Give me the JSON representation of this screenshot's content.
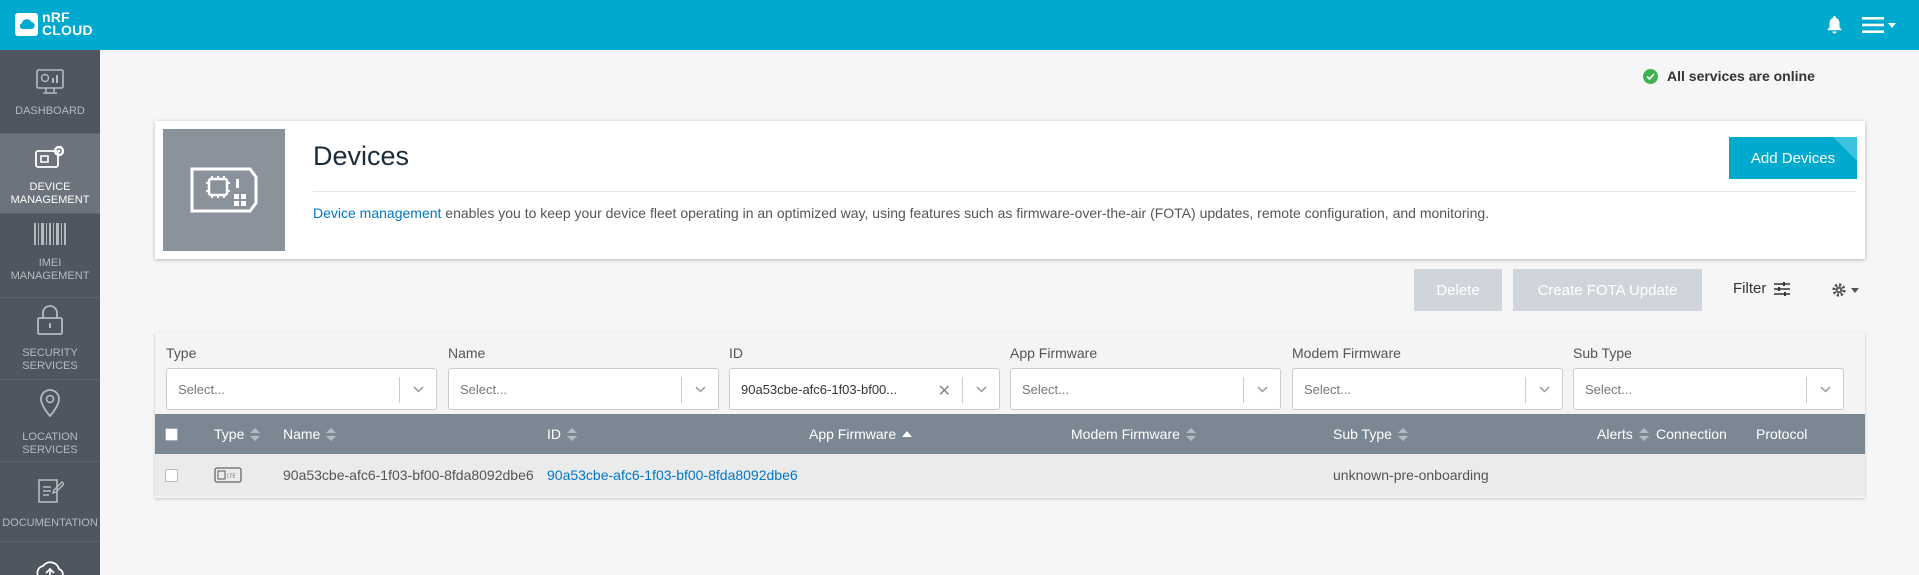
{
  "app": {
    "logo_line1": "nRF",
    "logo_line2": "CLOUD"
  },
  "sidebar": {
    "items": [
      {
        "label_line1": "DASHBOARD",
        "label_line2": ""
      },
      {
        "label_line1": "DEVICE",
        "label_line2": "MANAGEMENT"
      },
      {
        "label_line1": "IMEI",
        "label_line2": "MANAGEMENT"
      },
      {
        "label_line1": "SECURITY",
        "label_line2": "SERVICES"
      },
      {
        "label_line1": "LOCATION",
        "label_line2": "SERVICES"
      },
      {
        "label_line1": "DOCUMENTATION",
        "label_line2": ""
      }
    ]
  },
  "status": {
    "text": "All services are online",
    "color": "#3fb24f"
  },
  "devices_card": {
    "title": "Devices",
    "desc_link": "Device management",
    "desc_text": " enables you to keep your device fleet operating in an optimized way, using features such as firmware-over-the-air (FOTA) updates, remote configuration, and monitoring.",
    "add_button": "Add Devices"
  },
  "toolbar": {
    "delete": "Delete",
    "create_fota": "Create FOTA Update",
    "filter": "Filter"
  },
  "filters": [
    {
      "label": "Type",
      "placeholder": "Select..."
    },
    {
      "label": "Name",
      "placeholder": "Select..."
    },
    {
      "label": "ID",
      "value": "90a53cbe-afc6-1f03-bf00..."
    },
    {
      "label": "App Firmware",
      "placeholder": "Select..."
    },
    {
      "label": "Modem Firmware",
      "placeholder": "Select..."
    },
    {
      "label": "Sub Type",
      "placeholder": "Select..."
    }
  ],
  "table": {
    "columns": [
      "Type",
      "Name",
      "ID",
      "App Firmware",
      "Modem Firmware",
      "Sub Type",
      "Alerts",
      "Connection",
      "Protocol"
    ],
    "rows": [
      {
        "type_icon": "lte-device-icon",
        "type_badge": "LTE",
        "name": "90a53cbe-afc6-1f03-bf00-8fda8092dbe6",
        "id": "90a53cbe-afc6-1f03-bf00-8fda8092dbe6",
        "app_firmware": "",
        "modem_firmware": "",
        "sub_type": "unknown-pre-onboarding",
        "alerts": "",
        "connection": "",
        "protocol": ""
      }
    ]
  },
  "colors": {
    "brand": "#00a9ce",
    "sidebar": "#4f5660",
    "link": "#0077c8"
  }
}
